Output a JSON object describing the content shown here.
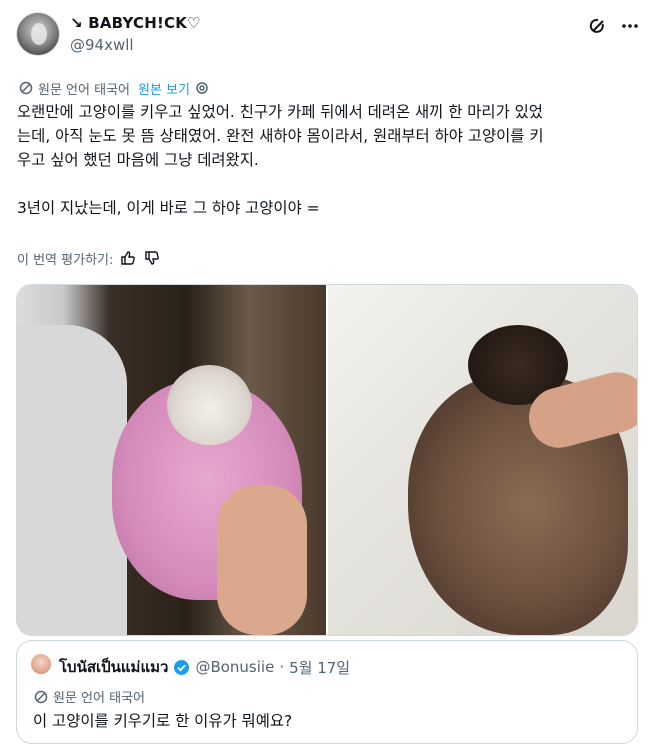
{
  "author": {
    "name_prefix": "↘",
    "display_name": "BABYCH!CK♡",
    "handle": "@94xwll"
  },
  "translation": {
    "source_label": "원문 언어 태국어",
    "view_original": "원본 보기"
  },
  "tweet": {
    "text": "오랜만에 고양이를 키우고 싶었어. 친구가 카페 뒤에서 데려온 새끼 한 마리가 있었\n는데, 아직 눈도 못 뜸 상태였어. 완전 새하야 몸이라서, 원래부터 하야 고양이를 키\n우고 싶어 했던 마음에 그냥 데려왔지.\n\n3년이 지났는데, 이게 바로 그 하야 고양이야 ="
  },
  "rating": {
    "label": "이 번역 평가하기:"
  },
  "quote": {
    "display_name": "โบนัสเป็นแม่แมว",
    "handle": "@Bonusiie",
    "dot": "·",
    "date": "5월 17일",
    "translation_label": "원문 언어 태국어",
    "text": "이 고양이를 키우기로 한 이유가 뭐예요?"
  },
  "colors": {
    "accent": "#1d9bf0",
    "secondary_text": "#536471",
    "border": "#cfd9de"
  },
  "icons": {
    "grok": "grok-icon",
    "more": "more-icon",
    "translate": "translate-icon",
    "settings": "gear-icon",
    "thumbs_up": "thumbs-up-icon",
    "thumbs_down": "thumbs-down-icon",
    "verified": "verified-badge-icon"
  }
}
